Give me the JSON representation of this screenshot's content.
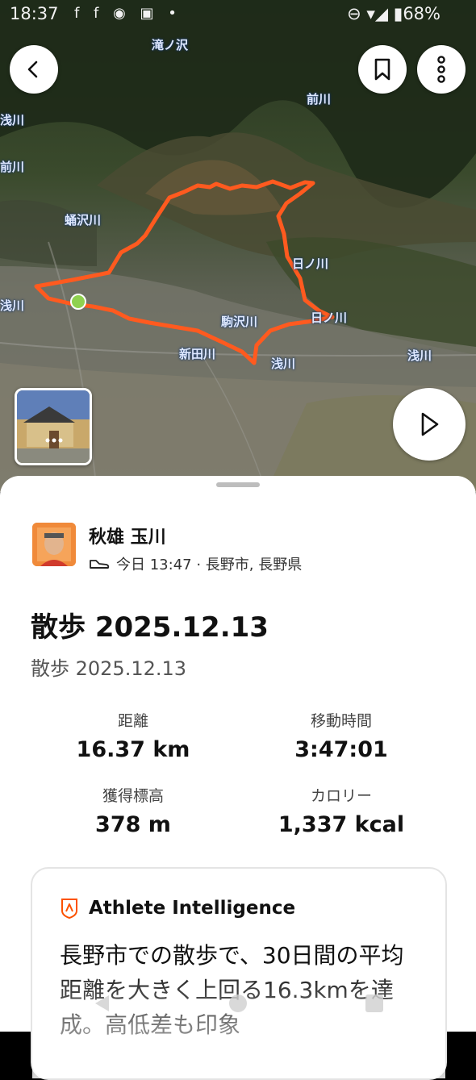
{
  "status_bar": {
    "time": "18:37",
    "notification_icons": "f f ◉ ▣ •",
    "right": "⊖ ▾◢ ▮68%"
  },
  "map": {
    "river_labels": [
      "滝ノ沢",
      "前川",
      "浅川",
      "蛹沢川",
      "浅川",
      "日ノ川",
      "日ノ川",
      "駒沢川",
      "新田川",
      "浅川",
      "浅川",
      "前川"
    ]
  },
  "buttons": {
    "back_icon": "chevron-left-icon",
    "bookmark_icon": "bookmark-icon",
    "more_icon": "more-vertical-icon",
    "play_icon": "play-icon"
  },
  "athlete": {
    "name": "秋雄 玉川",
    "activity_icon": "shoe-icon",
    "meta": "今日 13:47 · 長野市, 長野県"
  },
  "activity": {
    "title": "散歩 2025.12.13",
    "subtitle": "散歩 2025.12.13"
  },
  "stats": [
    {
      "label": "距離",
      "value": "16.37 km"
    },
    {
      "label": "移動時間",
      "value": "3:47:01"
    },
    {
      "label": "獲得標高",
      "value": "378 m"
    },
    {
      "label": "カロリー",
      "value": "1,337 kcal"
    }
  ],
  "ai_card": {
    "title": "Athlete Intelligence",
    "body": "長野市での散歩で、30日間の平均距離を大きく上回る16.3kmを達成。高低差も印象"
  },
  "colors": {
    "route": "#ff5a1f",
    "start_marker": "#8fd14f",
    "sheet_bg": "#ffffff"
  }
}
